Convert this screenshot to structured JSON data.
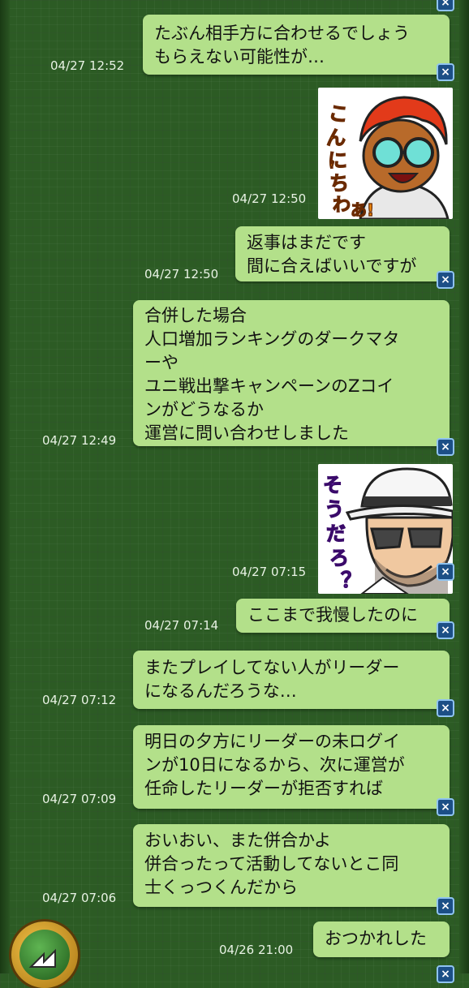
{
  "messages": [
    {
      "lines": [
        "たぶん相手方に合わせるでしょう",
        "もらえない可能性が…"
      ],
      "time": "04/27 12:52"
    },
    {
      "sticker": "gamer-goggles-sticker",
      "sticker_text": "こんにちわーあ！",
      "time": "04/27 12:50"
    },
    {
      "lines": [
        "返事はまだです",
        "間に合えばいいですが"
      ],
      "time": "04/27 12:50"
    },
    {
      "lines": [
        "合併した場合",
        "人口増加ランキングのダークマタ",
        "ーや",
        "ユニ戦出撃キャンペーンのZコイ",
        "ンがどうなるか",
        "運営に問い合わせしました"
      ],
      "time": "04/27 12:49"
    },
    {
      "sticker": "fedora-sunglasses-sticker",
      "sticker_text": "そうだろ？",
      "time": "04/27 07:15"
    },
    {
      "lines": [
        "ここまで我慢したのに"
      ],
      "time": "04/27 07:14"
    },
    {
      "lines": [
        "またプレイしてない人がリーダー",
        "になるんだろうな…"
      ],
      "time": "04/27 07:12"
    },
    {
      "lines": [
        "明日の夕方にリーダーの未ログイ",
        "ンが10日になるから、次に運営が",
        "任命したリーダーが拒否すれば"
      ],
      "time": "04/27 07:09"
    },
    {
      "lines": [
        "おいおい、また併合かよ",
        "併合ったって活動してないとこ同",
        "士くっつくんだから"
      ],
      "time": "04/27 07:06"
    },
    {
      "lines": [
        "おつかれした"
      ],
      "time": "04/26 21:00"
    }
  ],
  "icons": {
    "delete": "close-icon",
    "home": "home-icon"
  },
  "colors": {
    "bubble": "#b3e08a",
    "background": "#2c5b24",
    "delete_button": "#1c4f86"
  }
}
